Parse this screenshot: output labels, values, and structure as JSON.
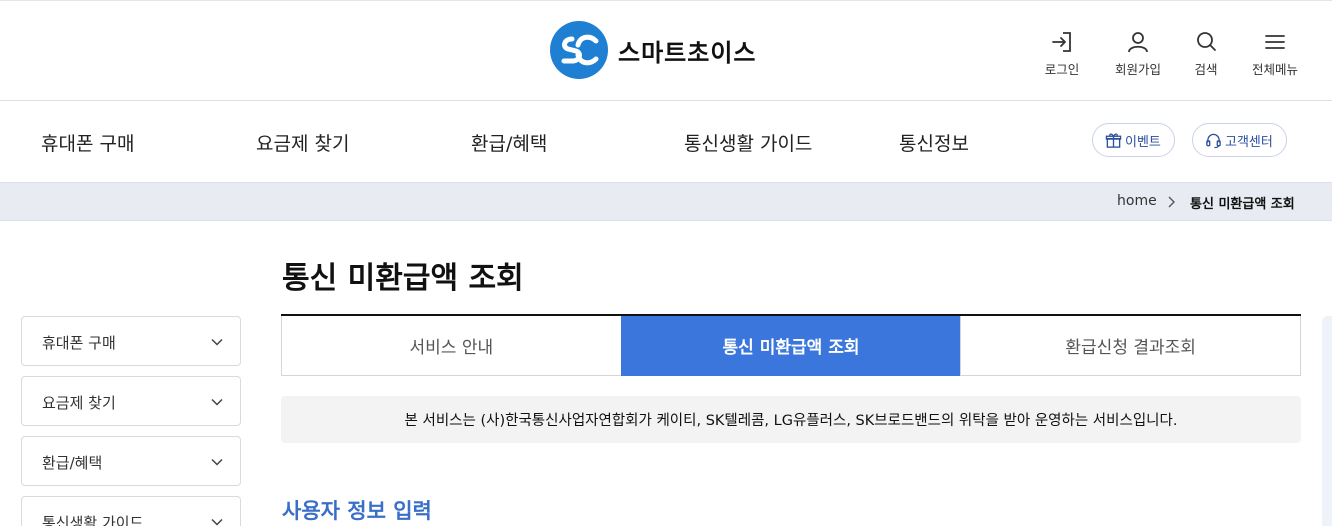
{
  "brand": {
    "name": "스마트초이스",
    "colors": {
      "primary": "#3a76dc",
      "logo": "#1f7fd3",
      "section_title": "#3a6fc9"
    }
  },
  "header": {
    "utility": [
      {
        "icon": "login-icon",
        "label": "로그인"
      },
      {
        "icon": "user-icon",
        "label": "회원가입"
      },
      {
        "icon": "search-icon",
        "label": "검색"
      },
      {
        "icon": "menu-icon",
        "label": "전체메뉴"
      }
    ]
  },
  "gnb": {
    "items": [
      "휴대폰 구매",
      "요금제 찾기",
      "환급/혜택",
      "통신생활 가이드",
      "통신정보"
    ],
    "event_label": "이벤트",
    "support_label": "고객센터"
  },
  "breadcrumb": {
    "home": "home",
    "current": "통신 미환급액 조회"
  },
  "sidebar": {
    "items": [
      "휴대폰 구매",
      "요금제 찾기",
      "환급/혜택",
      "통신생활 가이드"
    ]
  },
  "main": {
    "title": "통신 미환급액 조회",
    "tabs": [
      {
        "label": "서비스 안내",
        "active": false
      },
      {
        "label": "통신 미환급액 조회",
        "active": true
      },
      {
        "label": "환급신청 결과조회",
        "active": false
      }
    ],
    "notice": "본 서비스는 (사)한국통신사업자연합회가 케이티, SK텔레콤, LG유플러스, SK브로드밴드의 위탁을 받아 운영하는 서비스입니다.",
    "section_title": "사용자 정보 입력"
  }
}
